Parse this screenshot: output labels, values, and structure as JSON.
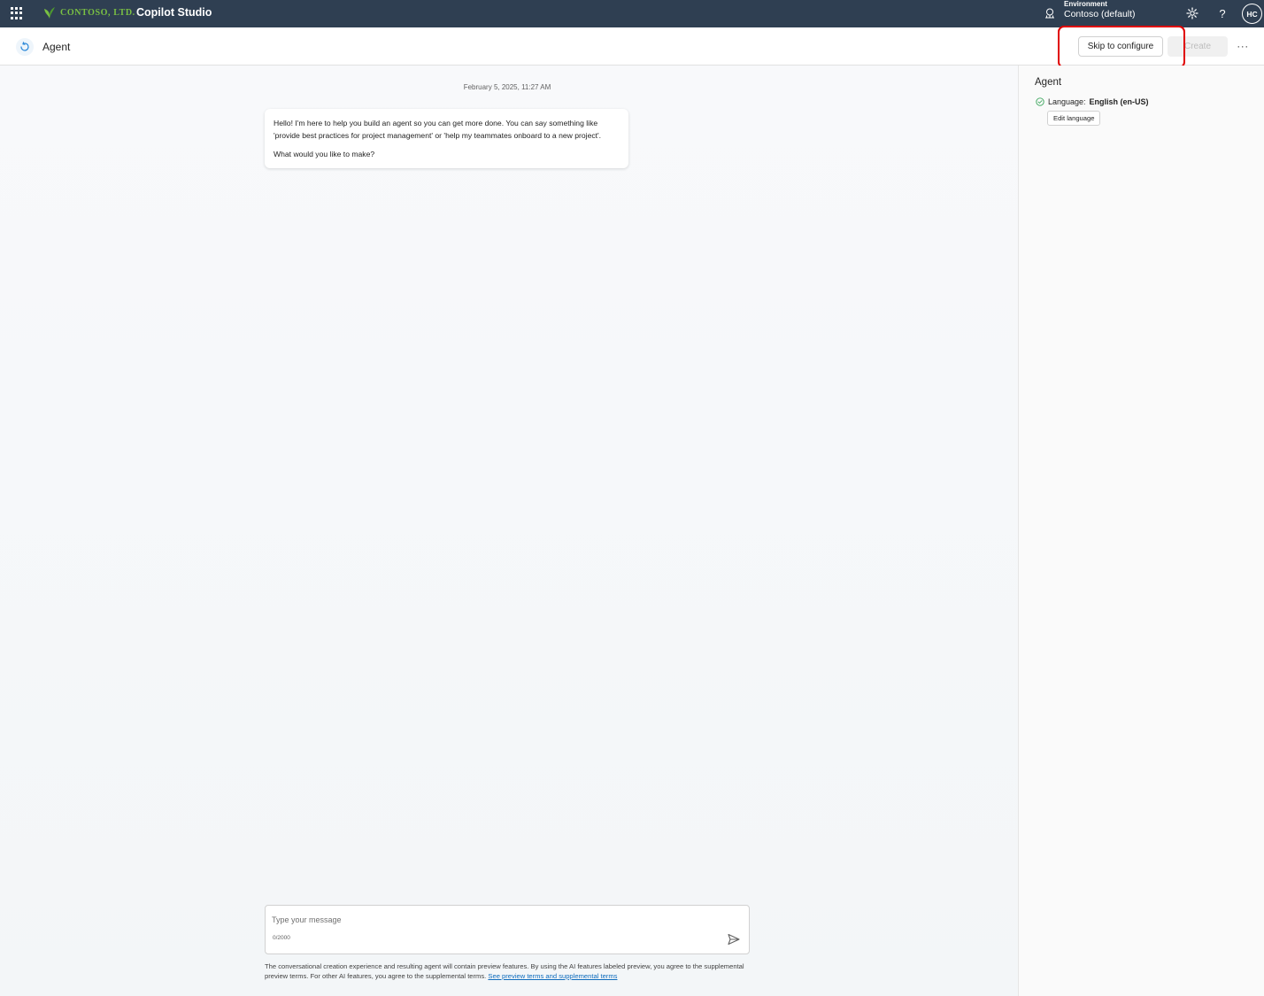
{
  "topbar": {
    "brand_name": "CONTOSO, LTD.",
    "product_name": "Copilot Studio",
    "environment_label": "Environment",
    "environment_value": "Contoso (default)",
    "avatar_initials": "HC",
    "background_color": "#2f3f52",
    "brand_color": "#7ac143"
  },
  "header": {
    "title": "Agent",
    "skip_label": "Skip to configure",
    "create_label": "Create",
    "more_label": "···"
  },
  "chat": {
    "timestamp": "February 5, 2025, 11:27 AM",
    "messages": [
      {
        "paragraphs": [
          "Hello! I'm here to help you build an agent so you can get more done. You can say something like 'provide best practices for project management' or 'help my teammates onboard to a new project'.",
          "What would you like to make?"
        ]
      }
    ],
    "composer": {
      "placeholder": "Type your message",
      "value": "",
      "counter": "0/2000"
    },
    "disclaimer_text": "The conversational creation experience and resulting agent will contain preview features. By using the AI features labeled preview, you agree to the supplemental preview terms. For other AI features, you agree to the supplemental terms.",
    "disclaimer_link": "See preview terms and supplemental terms"
  },
  "panel": {
    "title": "Agent",
    "language_label": "Language:",
    "language_value": "English (en-US)",
    "edit_language_label": "Edit language"
  },
  "colors": {
    "highlight": "#e00000",
    "link": "#0f6cbd",
    "success": "#3ba55c"
  }
}
